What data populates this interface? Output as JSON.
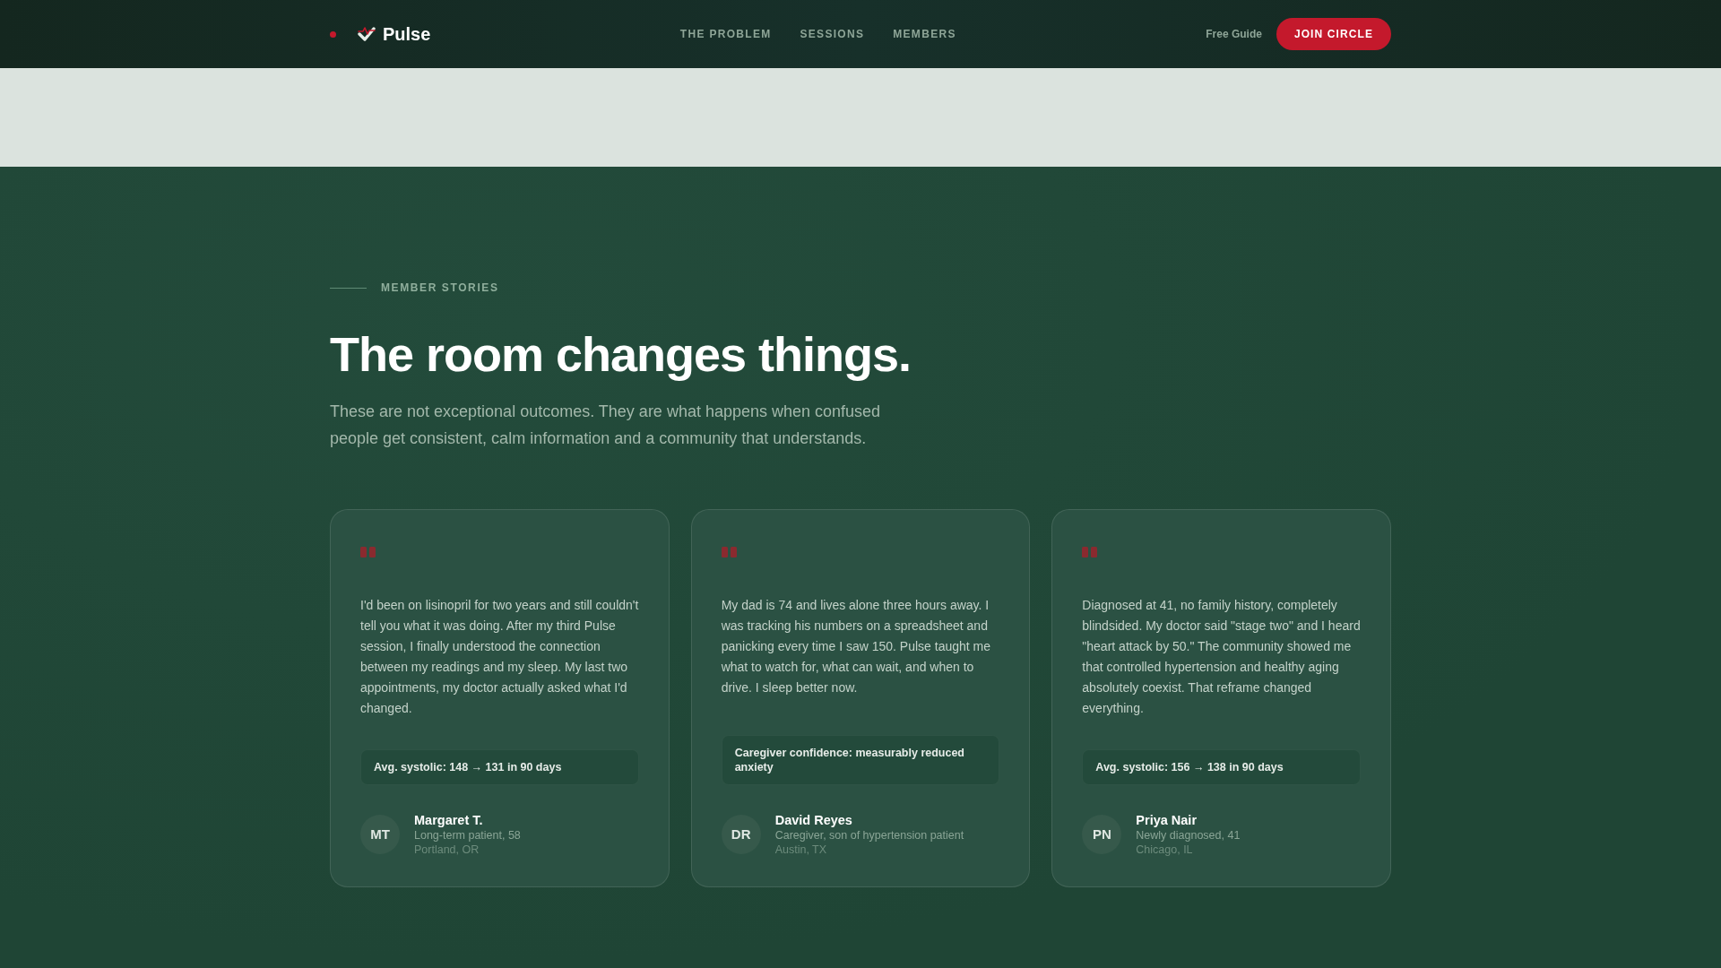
{
  "nav": {
    "brand": "Pulse",
    "links": [
      "THE PROBLEM",
      "SESSIONS",
      "MEMBERS"
    ],
    "secondary_link": "Free Guide",
    "cta": "JOIN CIRCLE"
  },
  "section": {
    "eyebrow": "MEMBER STORIES",
    "title": "The room changes things.",
    "subtitle": "These are not exceptional outcomes. They are what happens when confused people get consistent, calm information and a community that understands."
  },
  "testimonials": [
    {
      "quote": "I'd been on lisinopril for two years and still couldn't tell you what it was doing. After my third Pulse session, I finally understood the connection between my readings and my sleep. My last two appointments, my doctor actually asked what I'd changed.",
      "metric": "Avg. systolic: 148 → 131 in 90 days",
      "initials": "MT",
      "name": "Margaret T.",
      "role": "Long-term patient, 58",
      "location": "Portland, OR"
    },
    {
      "quote": "My dad is 74 and lives alone three hours away. I was tracking his numbers on a spreadsheet and panicking every time I saw 150. Pulse taught me what to watch for, what can wait, and when to drive. I sleep better now.",
      "metric": "Caregiver confidence: measurably reduced anxiety",
      "initials": "DR",
      "name": "David Reyes",
      "role": "Caregiver, son of hypertension patient",
      "location": "Austin, TX"
    },
    {
      "quote": "Diagnosed at 41, no family history, completely blindsided. My doctor said \"stage two\" and I heard \"heart attack by 50.\" The community showed me that controlled hypertension and healthy aging absolutely coexist. That reframe changed everything.",
      "metric": "Avg. systolic: 156 → 138 in 90 days",
      "initials": "PN",
      "name": "Priya Nair",
      "role": "Newly diagnosed, 41",
      "location": "Chicago, IL"
    }
  ]
}
